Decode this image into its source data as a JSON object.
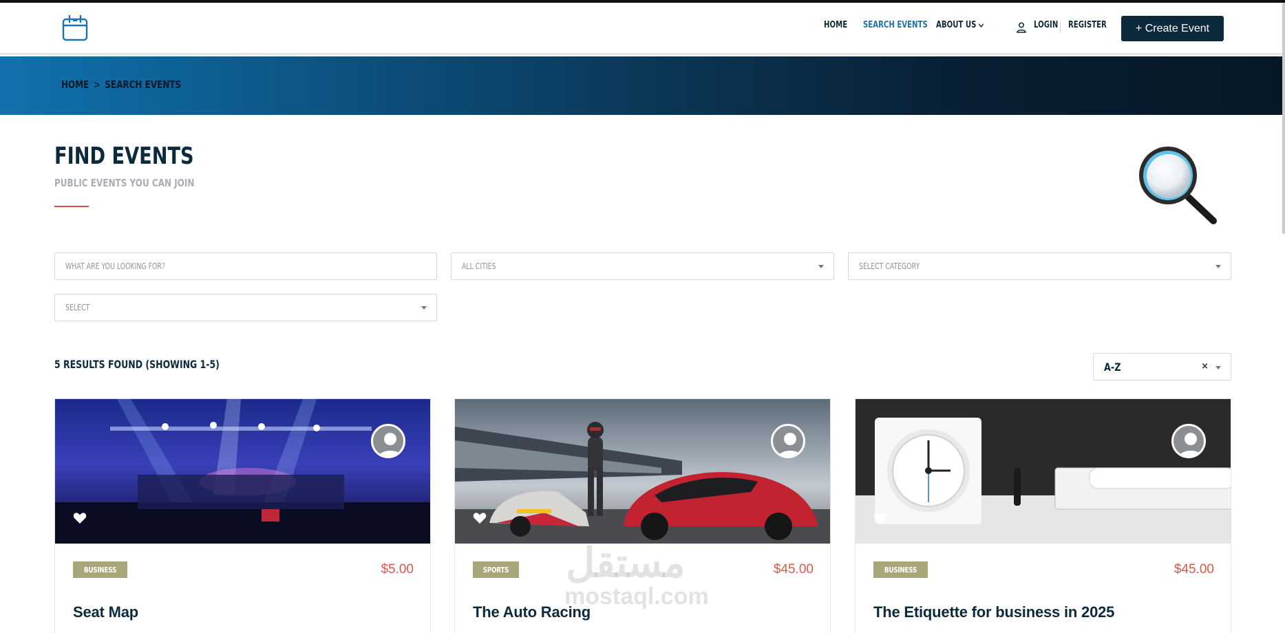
{
  "header": {
    "nav": {
      "home": "HOME",
      "search_events": "SEARCH EVENTS",
      "about_us": "ABOUT US",
      "login": "LOGIN",
      "register": "REGISTER"
    },
    "create_event": "+ Create Event"
  },
  "breadcrumb": {
    "home": "HOME",
    "separator": ">",
    "current": "SEARCH EVENTS"
  },
  "page": {
    "title": "FIND EVENTS",
    "subtitle": "PUBLIC EVENTS YOU CAN JOIN"
  },
  "filters": {
    "search_placeholder": "WHAT ARE YOU LOOKING FOR?",
    "city": "ALL CITIES",
    "category": "SELECT CATEGORY",
    "select": "SELECT"
  },
  "results": {
    "summary": "5 RESULTS FOUND (SHOWING 1-5)",
    "sort_value": "A-Z",
    "clear": "×"
  },
  "cards": [
    {
      "category": "BUSINESS",
      "price": "$5.00",
      "title": "Seat Map"
    },
    {
      "category": "SPORTS",
      "price": "$45.00",
      "title": "The Auto Racing"
    },
    {
      "category": "BUSINESS",
      "price": "$45.00",
      "title": "The Etiquette for business in 2025"
    }
  ],
  "watermark": {
    "arabic": "مستقل",
    "latin": "mostaql.com"
  },
  "colors": {
    "navy": "#0c2a3d",
    "accent_blue": "#1a74b4",
    "price_red": "#e0574a",
    "badge_olive": "#a9a77a"
  }
}
